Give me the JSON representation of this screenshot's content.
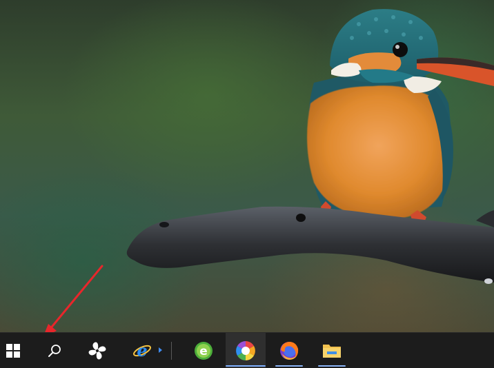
{
  "wallpaper": {
    "subject": "kingfisher-on-branch"
  },
  "annotation": {
    "arrow_color": "#e8262b",
    "points_to": "search-button"
  },
  "taskbar": {
    "background": "#1c1c1c",
    "items": [
      {
        "name": "start-button",
        "icon": "windows-logo-icon",
        "running": false,
        "active": false
      },
      {
        "name": "search-button",
        "icon": "search-icon",
        "running": false,
        "active": false
      },
      {
        "name": "pinwheel-app-button",
        "icon": "pinwheel-icon",
        "running": false,
        "active": false
      },
      {
        "name": "internet-explorer-button",
        "icon": "internet-explorer-icon",
        "running": false,
        "active": false
      },
      {
        "name": "360-browser-button",
        "icon": "green-e-browser-icon",
        "running": false,
        "active": false
      },
      {
        "name": "colorful-app-button",
        "icon": "rainbow-swirl-icon",
        "running": true,
        "active": true
      },
      {
        "name": "firefox-button",
        "icon": "firefox-icon",
        "running": true,
        "active": false
      },
      {
        "name": "file-explorer-button",
        "icon": "folder-icon",
        "running": true,
        "active": false
      }
    ]
  }
}
